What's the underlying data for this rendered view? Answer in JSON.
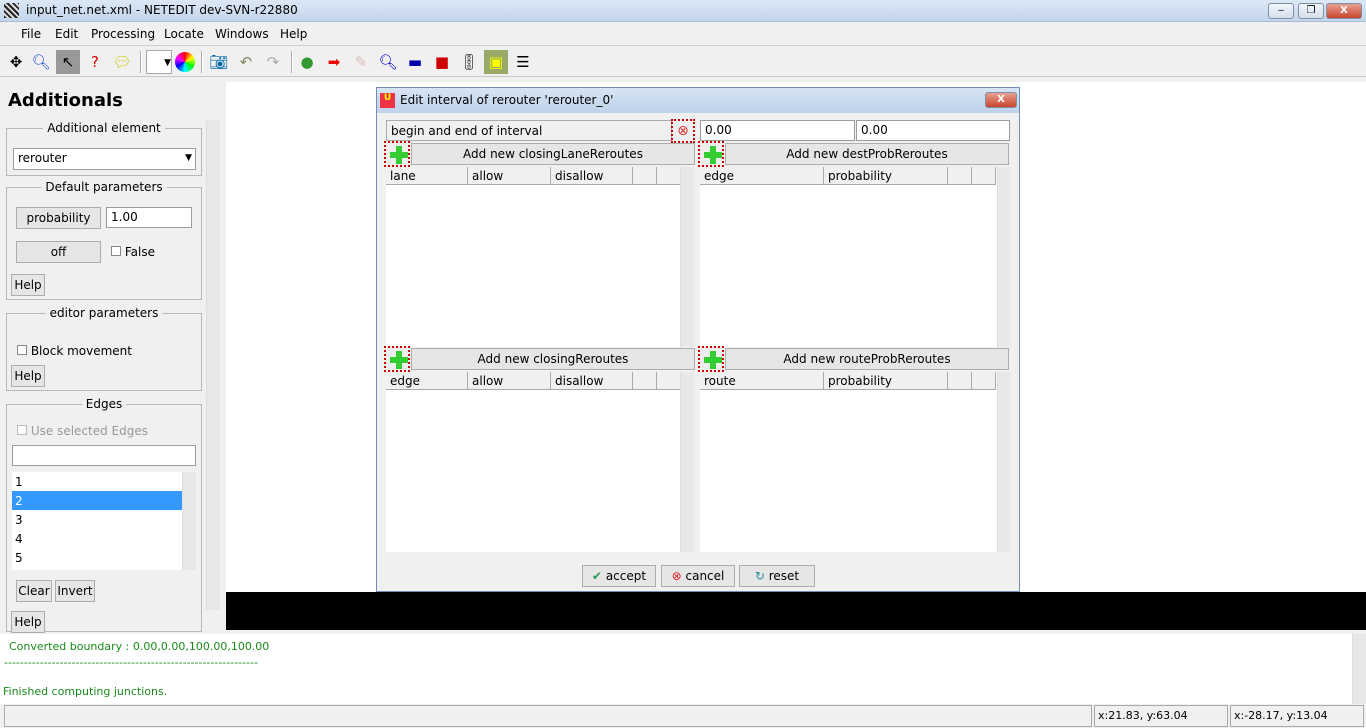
{
  "window": {
    "title": "input_net.net.xml - NETEDIT dev-SVN-r22880",
    "min": "‒",
    "max": "❐",
    "close": "X"
  },
  "menu": [
    "File",
    "Edit",
    "Processing",
    "Locate",
    "Windows",
    "Help"
  ],
  "toolbar_icons": [
    "move-icon",
    "zoom-icon",
    "inspect-icon",
    "delete-icon",
    "select-icon",
    "dropdown",
    "color-wheel-icon",
    "screenshot-icon",
    "undo-icon",
    "redo-icon",
    "connection-icon",
    "arrow-icon",
    "eraser-icon",
    "search-icon",
    "lane-icon",
    "junction-icon",
    "traffic-light-icon",
    "additional-icon",
    "list-icon"
  ],
  "left": {
    "title": "Additionals",
    "additional_element": {
      "label": "Additional element",
      "value": "rerouter"
    },
    "default_params": {
      "label": "Default parameters",
      "prob_label": "probability",
      "prob_value": "1.00",
      "off_label": "off",
      "false_label": "False",
      "help": "Help"
    },
    "editor_params": {
      "label": "editor parameters",
      "block": "Block movement",
      "help": "Help"
    },
    "edges": {
      "label": "Edges",
      "use_selected": "Use selected Edges",
      "items": [
        "1",
        "2",
        "3",
        "4",
        "5"
      ],
      "selected": "2",
      "clear": "Clear",
      "invert": "Invert",
      "help": "Help"
    }
  },
  "dialog": {
    "title": "Edit interval of rerouter 'rerouter_0'",
    "interval_label": "begin and end of interval",
    "begin": "0.00",
    "end": "0.00",
    "closing_lane": {
      "button": "Add new closingLaneReroutes",
      "cols": [
        "lane",
        "allow",
        "disallow"
      ]
    },
    "dest_prob": {
      "button": "Add new destProbReroutes",
      "cols": [
        "edge",
        "probability"
      ]
    },
    "closing": {
      "button": "Add new closingReroutes",
      "cols": [
        "edge",
        "allow",
        "disallow"
      ]
    },
    "route_prob": {
      "button": "Add new routeProbReroutes",
      "cols": [
        "route",
        "probability"
      ]
    },
    "accept": "accept",
    "cancel": "cancel",
    "reset": "reset"
  },
  "messages": [
    "Converted boundary : 0.00,0.00,100.00,100.00",
    "----------------------------------------------------------------",
    "Finished computing junctions."
  ],
  "status": {
    "coord1": "x:21.83, y:63.04",
    "coord2": "x:-28.17, y:13.04"
  }
}
